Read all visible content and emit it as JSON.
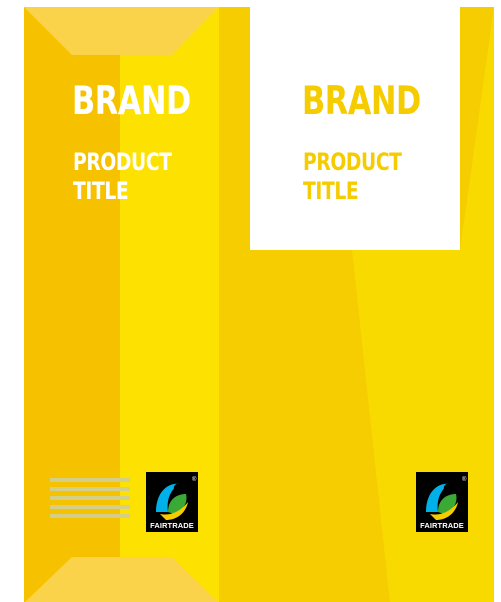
{
  "colors": {
    "dark_yellow": "#f6c200",
    "mid_yellow": "#fbd200",
    "bright_yellow": "#fde100",
    "light_flap": "#fbd34a",
    "white": "#ffffff"
  },
  "front_panel": {
    "brand": "BRAND",
    "product_line1": "PRODUCT",
    "product_line2": "TITLE",
    "certification": "FAIRTRADE"
  },
  "side_panel": {
    "brand": "BRAND",
    "product_line1": "PRODUCT",
    "product_line2": "TITLE",
    "certification": "FAIRTRADE"
  },
  "icons": {
    "fairtrade": "fairtrade-mark-icon",
    "barcode": "barcode-stripes-icon"
  }
}
